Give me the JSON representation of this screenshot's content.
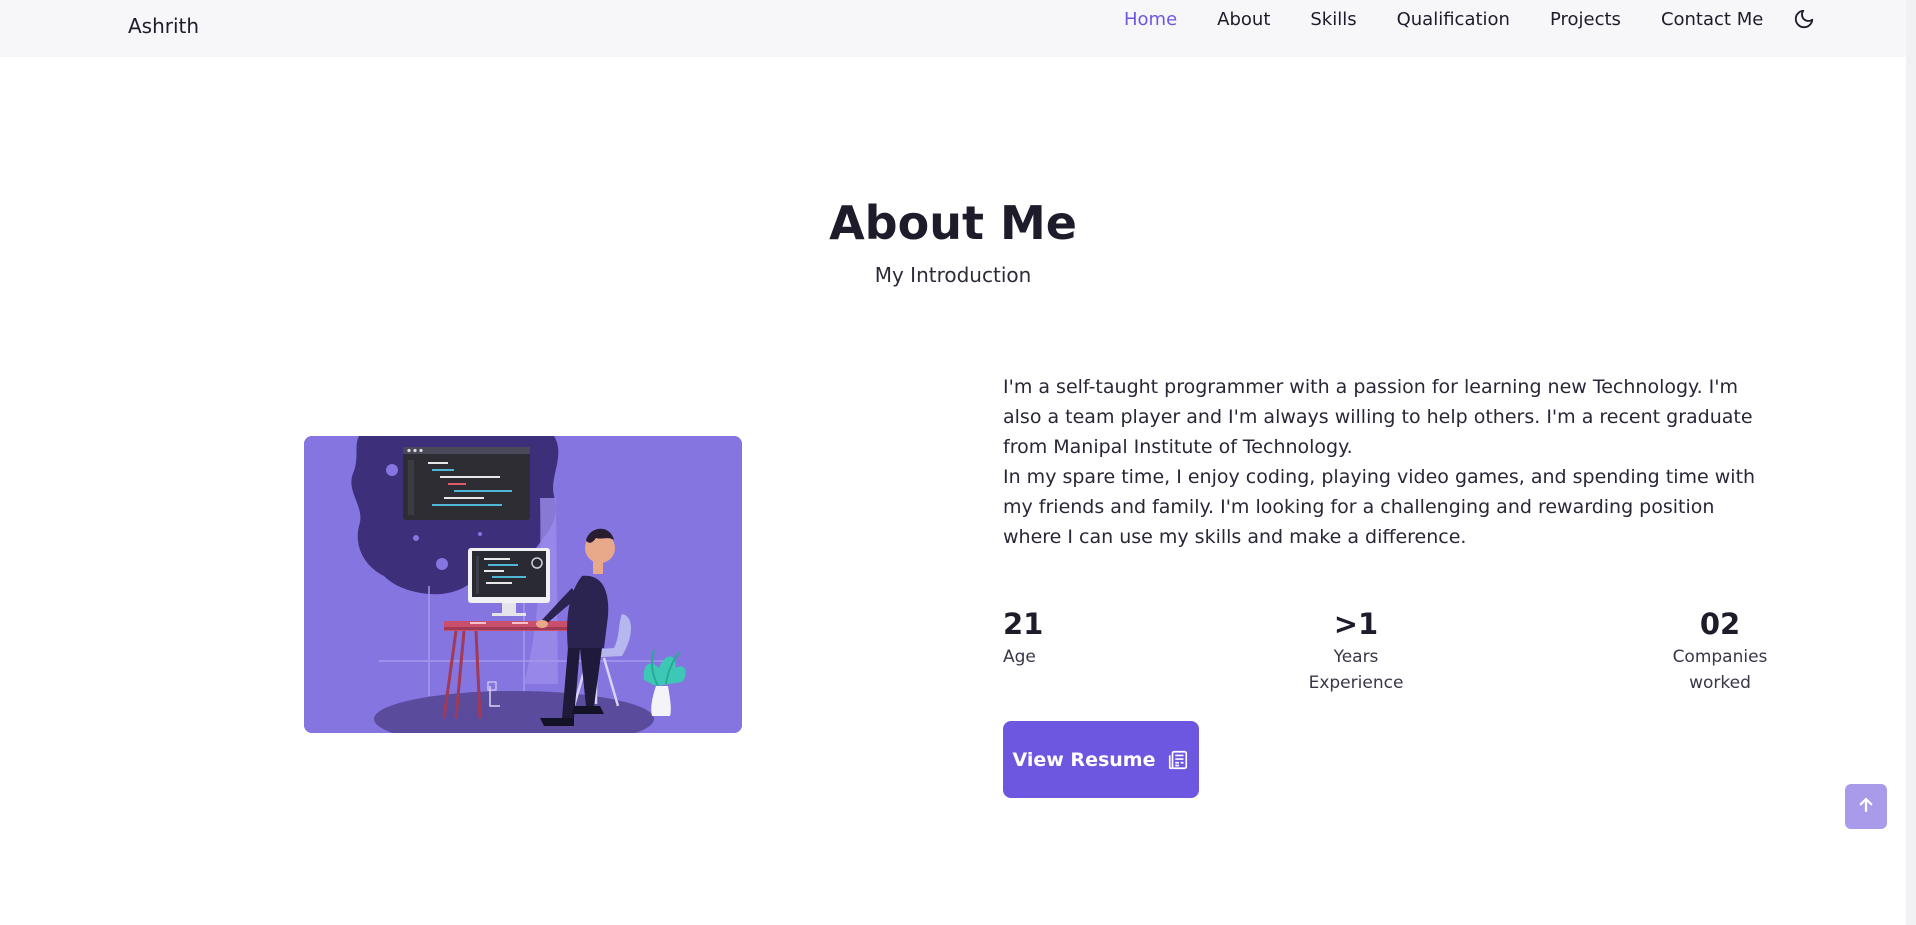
{
  "nav": {
    "brand": "Ashrith",
    "links": [
      {
        "label": "Home",
        "active": true
      },
      {
        "label": "About"
      },
      {
        "label": "Skills"
      },
      {
        "label": "Qualification"
      },
      {
        "label": "Projects"
      },
      {
        "label": "Contact Me"
      }
    ],
    "theme_icon": "moon-icon"
  },
  "about": {
    "title": "About Me",
    "subtitle": "My Introduction",
    "paragraph_1": "I'm a self-taught programmer with a passion for learning new Technology. I'm also a team player and I'm always willing to help others. I'm a recent graduate from Manipal Institute of Technology.",
    "paragraph_2": "In my spare time, I enjoy coding, playing video games, and spending time with my friends and family. I'm looking for a challenging and rewarding position where I can use my skills and make a difference.",
    "stats": [
      {
        "number": "21",
        "label_1": "Age",
        "label_2": ""
      },
      {
        "number": ">1",
        "label_1": "Years",
        "label_2": "Experience"
      },
      {
        "number": "02",
        "label_1": "Companies",
        "label_2": "worked"
      }
    ],
    "resume_button": "View Resume",
    "resume_icon": "document-icon"
  },
  "scroll_up_icon": "arrow-up-icon",
  "colors": {
    "accent": "#6e57e0",
    "illustration_bg": "#8575e0",
    "scroll_up_bg": "#a99be9",
    "nav_bg": "#f7f7fa"
  }
}
